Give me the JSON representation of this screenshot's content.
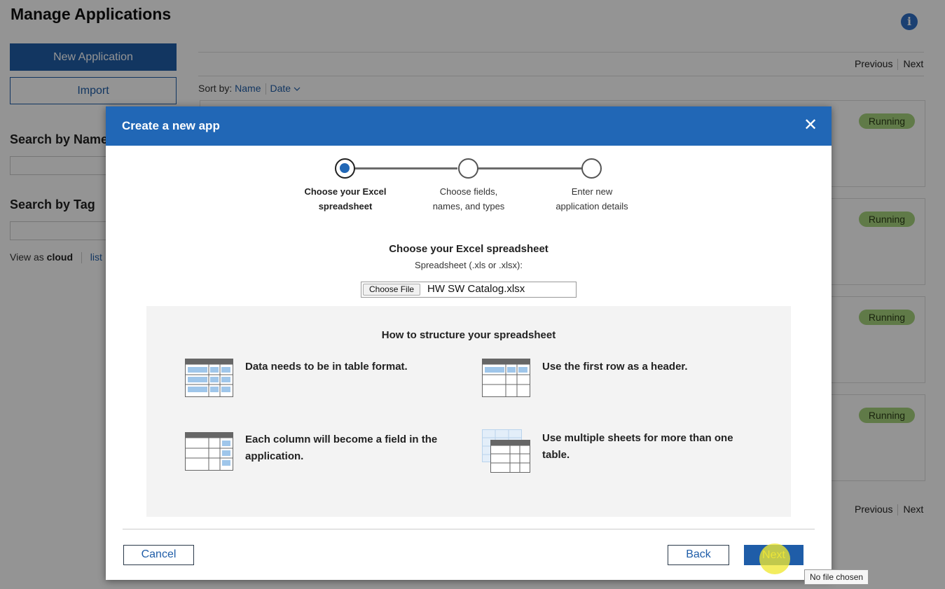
{
  "background": {
    "page_title": "Manage Applications",
    "info_icon": "info-icon",
    "new_application_label": "New Application",
    "import_label": "Import",
    "search_by_name_label": "Search by Name",
    "search_by_tag_label": "Search by Tag",
    "view_as": {
      "prefix": "View as",
      "cloud": "cloud",
      "list": "list"
    },
    "pager": {
      "previous": "Previous",
      "next": "Next"
    },
    "sort": {
      "label": "Sort by:",
      "name": "Name",
      "date": "Date"
    },
    "cards": [
      {
        "status": "Running"
      },
      {
        "status": "Running"
      },
      {
        "status": "Running"
      },
      {
        "status": "Running"
      }
    ]
  },
  "modal": {
    "title": "Create a new app",
    "close_icon": "close-icon",
    "steps": [
      {
        "line1": "Choose your Excel",
        "line2": "spreadsheet",
        "active": true
      },
      {
        "line1": "Choose fields,",
        "line2": "names, and types",
        "active": false
      },
      {
        "line1": "Enter new",
        "line2": "application details",
        "active": false
      }
    ],
    "choose_title": "Choose your Excel spreadsheet",
    "choose_subtitle": "Spreadsheet (.xls or .xlsx):",
    "file_input": {
      "button_label": "Choose File",
      "file_name": "HW SW Catalog.xlsx"
    },
    "howto": {
      "title": "How to structure your spreadsheet",
      "tips": [
        {
          "icon": "table-format-icon",
          "text": "Data needs to be in table format."
        },
        {
          "icon": "header-row-icon",
          "text": "Use the first row as a header."
        },
        {
          "icon": "column-field-icon",
          "line1": "Each column will become a field in the",
          "line2": "application."
        },
        {
          "icon": "multiple-sheets-icon",
          "line1": "Use multiple sheets for more than one",
          "line2": "table."
        }
      ]
    },
    "buttons": {
      "cancel": "Cancel",
      "back": "Back",
      "next": "Next"
    }
  },
  "tooltip": "No file chosen",
  "colors": {
    "primary": "#2167b6",
    "badge": "#a6d27c"
  }
}
